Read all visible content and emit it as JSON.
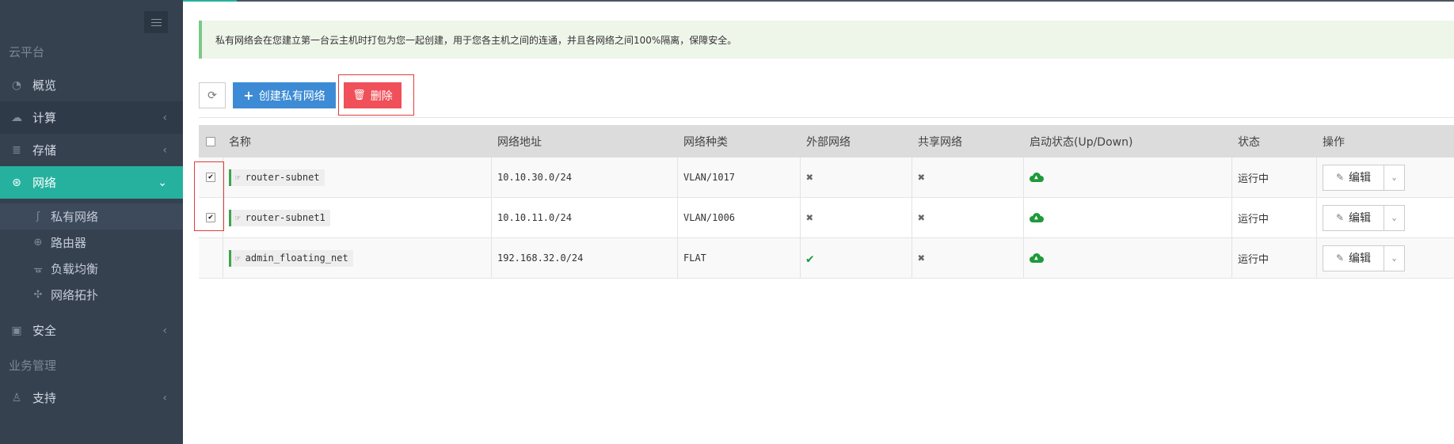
{
  "sidebar": {
    "heading_cloud": "云平台",
    "heading_business": "业务管理",
    "items": [
      {
        "label": "概览",
        "icon": "dashboard-icon"
      },
      {
        "label": "计算",
        "icon": "cloud-icon"
      },
      {
        "label": "存储",
        "icon": "database-icon"
      },
      {
        "label": "网络",
        "icon": "network-icon"
      },
      {
        "label": "安全",
        "icon": "shield-icon"
      },
      {
        "label": "支持",
        "icon": "support-icon"
      }
    ],
    "sub_items": [
      {
        "label": "私有网络",
        "icon": "rss-icon"
      },
      {
        "label": "路由器",
        "icon": "globe-icon"
      },
      {
        "label": "负载均衡",
        "icon": "sitemap-icon"
      },
      {
        "label": "网络拓扑",
        "icon": "puzzle-icon"
      }
    ]
  },
  "alert": {
    "text": "私有网络会在您建立第一台云主机时打包为您一起创建，用于您各主机之间的连通，并且各网络之间100%隔离，保障安全。"
  },
  "toolbar": {
    "create_label": "创建私有网络",
    "delete_label": "删除"
  },
  "table": {
    "headers": {
      "name": "名称",
      "address": "网络地址",
      "type": "网络种类",
      "external": "外部网络",
      "shared": "共享网络",
      "admin_state": "启动状态(Up/Down)",
      "status": "状态",
      "action": "操作"
    },
    "rows": [
      {
        "name": "router-subnet",
        "address": "10.10.30.0/24",
        "type": "VLAN/1017",
        "external": false,
        "shared": false,
        "admin_state": "up",
        "status": "运行中",
        "checked": true,
        "action": "编辑"
      },
      {
        "name": "router-subnet1",
        "address": "10.10.11.0/24",
        "type": "VLAN/1006",
        "external": false,
        "shared": false,
        "admin_state": "up",
        "status": "运行中",
        "checked": true,
        "action": "编辑"
      },
      {
        "name": "admin_floating_net",
        "address": "192.168.32.0/24",
        "type": "FLAT",
        "external": true,
        "shared": false,
        "admin_state": "up",
        "status": "运行中",
        "checked": false,
        "action": "编辑"
      }
    ]
  },
  "colors": {
    "sidebar_bg": "#364150",
    "active_accent": "#26b19f",
    "primary_button": "#3d8bd4",
    "danger_button": "#ef5059",
    "success": "#1e9a3a",
    "highlight_box": "#e23b3b"
  }
}
